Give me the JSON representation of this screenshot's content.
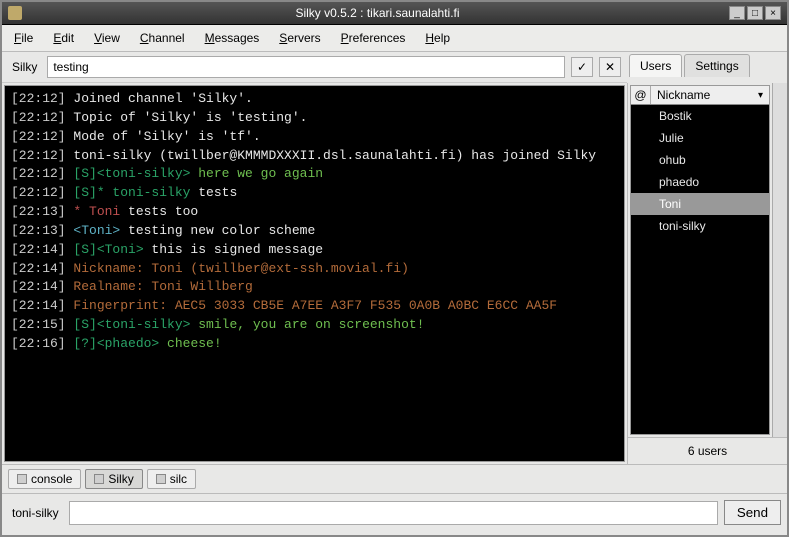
{
  "window": {
    "title": "Silky v0.5.2 : tikari.saunalahti.fi"
  },
  "menu": {
    "file": "File",
    "edit": "Edit",
    "view": "View",
    "channel": "Channel",
    "messages": "Messages",
    "servers": "Servers",
    "preferences": "Preferences",
    "help": "Help"
  },
  "topic": {
    "label": "Silky",
    "value": "testing",
    "ok_glyph": "✓",
    "close_glyph": "✕"
  },
  "side_tabs": {
    "users": "Users",
    "settings": "Settings"
  },
  "userlist": {
    "op_header": "@",
    "nick_header": "Nickname",
    "items": [
      {
        "nick": "Bostik",
        "selected": false
      },
      {
        "nick": "Julie",
        "selected": false
      },
      {
        "nick": "ohub",
        "selected": false
      },
      {
        "nick": "phaedo",
        "selected": false
      },
      {
        "nick": "Toni",
        "selected": true
      },
      {
        "nick": "toni-silky",
        "selected": false
      }
    ],
    "count": "6 users"
  },
  "channel_tabs": [
    {
      "label": "console",
      "active": false
    },
    {
      "label": "Silky",
      "active": true
    },
    {
      "label": "silc",
      "active": false
    }
  ],
  "input": {
    "nick": "toni-silky",
    "value": "",
    "send": "Send"
  },
  "chat": [
    {
      "ts": "[22:12]",
      "segs": [
        {
          "c": "col-white",
          "t": " Joined channel 'Silky'."
        }
      ]
    },
    {
      "ts": "[22:12]",
      "segs": [
        {
          "c": "col-white",
          "t": " Topic of 'Silky' is 'testing'."
        }
      ]
    },
    {
      "ts": "[22:12]",
      "segs": [
        {
          "c": "col-white",
          "t": " Mode of 'Silky' is 'tf'."
        }
      ]
    },
    {
      "ts": "[22:12]",
      "segs": [
        {
          "c": "col-white",
          "t": " toni-silky (twillber@KMMMDXXXII.dsl.saunalahti.fi) has joined Silky"
        }
      ]
    },
    {
      "ts": "[22:12]",
      "segs": [
        {
          "c": "col-green1",
          "t": " [S]<toni-silky>"
        },
        {
          "c": "col-green2",
          "t": " here we go again"
        }
      ]
    },
    {
      "ts": "[22:12]",
      "segs": [
        {
          "c": "col-green1",
          "t": " [S]* toni-silky"
        },
        {
          "c": "col-white",
          "t": " tests"
        }
      ]
    },
    {
      "ts": "[22:13]",
      "segs": [
        {
          "c": "col-red",
          "t": " * Toni"
        },
        {
          "c": "col-white",
          "t": " tests too"
        }
      ]
    },
    {
      "ts": "[22:13]",
      "segs": [
        {
          "c": "col-cyan",
          "t": " <Toni>"
        },
        {
          "c": "col-white",
          "t": " testing new color scheme"
        }
      ]
    },
    {
      "ts": "[22:14]",
      "segs": [
        {
          "c": "col-green1",
          "t": " [S]<Toni>"
        },
        {
          "c": "col-white",
          "t": " this is signed message"
        }
      ]
    },
    {
      "ts": "[22:14]",
      "segs": [
        {
          "c": "col-brown",
          "t": " Nickname: Toni (twillber@ext-ssh.movial.fi)"
        }
      ]
    },
    {
      "ts": "[22:14]",
      "segs": [
        {
          "c": "col-brown",
          "t": " Realname: Toni Willberg"
        }
      ]
    },
    {
      "ts": "[22:14]",
      "segs": [
        {
          "c": "col-brown",
          "t": " Fingerprint: AEC5 3033 CB5E A7EE A3F7  F535 0A0B A0BC E6CC AA5F"
        }
      ]
    },
    {
      "ts": "[22:15]",
      "segs": [
        {
          "c": "col-green1",
          "t": " [S]<toni-silky>"
        },
        {
          "c": "col-green2",
          "t": " smile, you are on screenshot!"
        }
      ]
    },
    {
      "ts": "[22:16]",
      "segs": [
        {
          "c": "col-green1",
          "t": " [?]<phaedo>"
        },
        {
          "c": "col-green2",
          "t": " cheese!"
        }
      ]
    }
  ]
}
